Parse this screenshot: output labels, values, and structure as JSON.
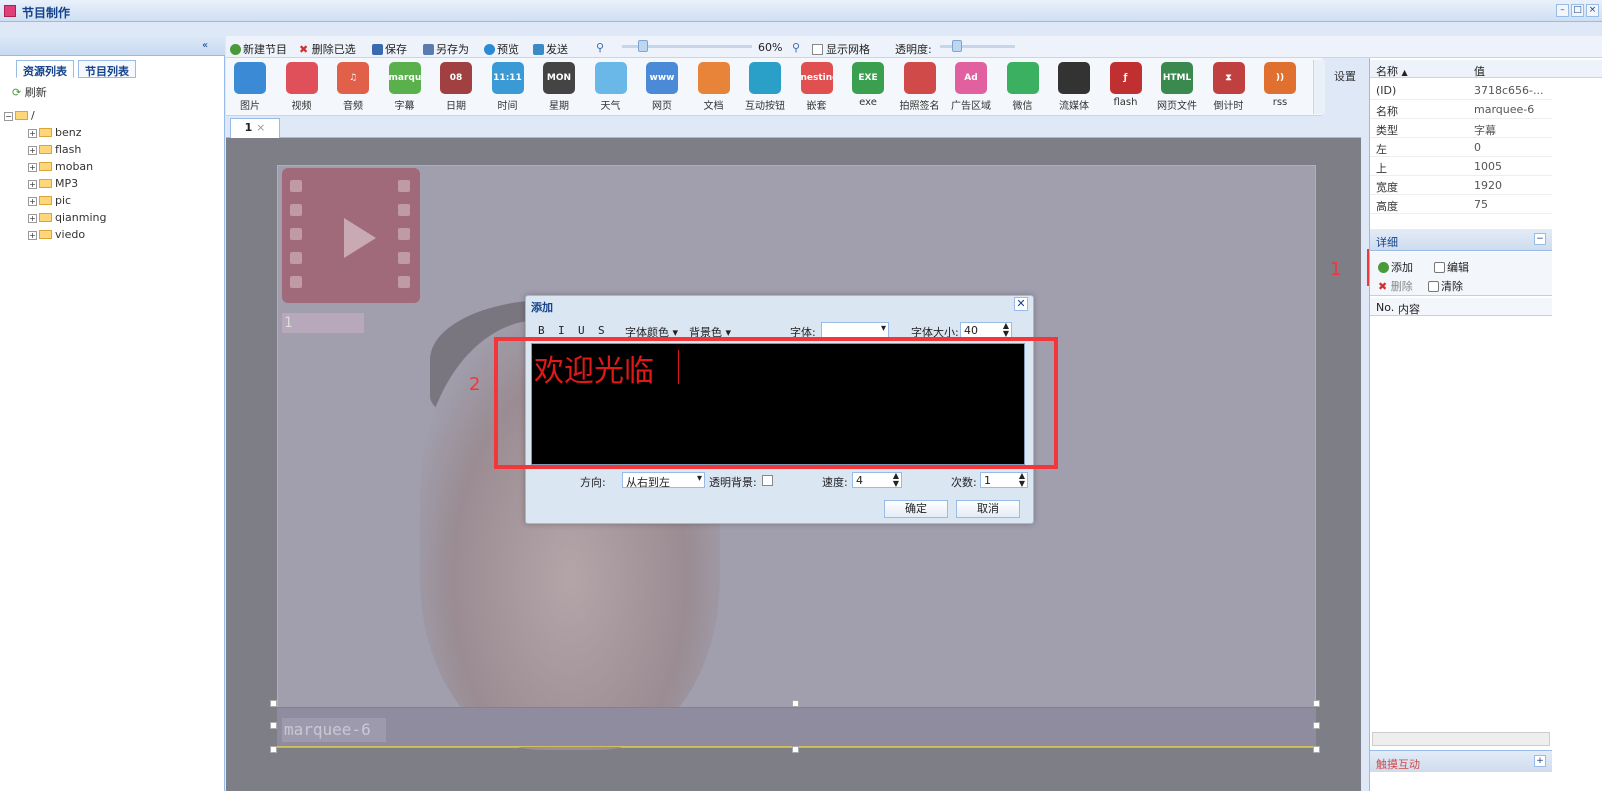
{
  "window": {
    "title": "节目制作"
  },
  "left_panel": {
    "tabs": [
      "资源列表",
      "节目列表"
    ],
    "refresh_label": "刷新",
    "root": "/",
    "folders": [
      "benz",
      "flash",
      "moban",
      "MP3",
      "pic",
      "qianming",
      "viedo"
    ]
  },
  "toolbar": {
    "new_program": "新建节目",
    "delete_selected": "删除已选",
    "save": "保存",
    "save_as": "另存为",
    "preview": "预览",
    "send": "发送",
    "zoom": "60%",
    "show_grid": "显示网格",
    "opacity": "透明度:"
  },
  "resources": [
    {
      "label": "图片",
      "icon": "image-icon",
      "color": "#3a8ad6"
    },
    {
      "label": "视频",
      "icon": "video-icon",
      "color": "#e0505a"
    },
    {
      "label": "音频",
      "icon": "music-icon",
      "color": "#e0604a",
      "glyph": "♫"
    },
    {
      "label": "字幕",
      "icon": "marquee-icon",
      "color": "#5ab04a",
      "glyph": "marquee"
    },
    {
      "label": "日期",
      "icon": "date-icon",
      "color": "#a04040",
      "glyph": "08"
    },
    {
      "label": "时间",
      "icon": "time-icon",
      "color": "#3a9ad6",
      "glyph": "11:11"
    },
    {
      "label": "星期",
      "icon": "weekday-icon",
      "color": "#444444",
      "glyph": "MON"
    },
    {
      "label": "天气",
      "icon": "weather-icon",
      "color": "#6ab8e8"
    },
    {
      "label": "网页",
      "icon": "webpage-icon",
      "color": "#4a8ad6",
      "glyph": "www"
    },
    {
      "label": "文档",
      "icon": "document-icon",
      "color": "#e8843a"
    },
    {
      "label": "互动按钮",
      "icon": "interactive-button-icon",
      "color": "#2aa0c8"
    },
    {
      "label": "嵌套",
      "icon": "nesting-icon",
      "color": "#e05050",
      "glyph": "nesting"
    },
    {
      "label": "exe",
      "icon": "exe-icon",
      "color": "#3aa050",
      "glyph": "EXE"
    },
    {
      "label": "拍照签名",
      "icon": "photo-sign-icon",
      "color": "#d04a4a"
    },
    {
      "label": "广告区域",
      "icon": "ad-area-icon",
      "color": "#e060a0",
      "glyph": "Ad"
    },
    {
      "label": "微信",
      "icon": "wechat-icon",
      "color": "#3ab060"
    },
    {
      "label": "流媒体",
      "icon": "streaming-icon",
      "color": "#333333"
    },
    {
      "label": "flash",
      "icon": "flash-icon",
      "color": "#c03030",
      "glyph": "ƒ"
    },
    {
      "label": "网页文件",
      "icon": "html-file-icon",
      "color": "#3a8a50",
      "glyph": "HTML"
    },
    {
      "label": "倒计时",
      "icon": "countdown-icon",
      "color": "#c04040",
      "glyph": "⧗"
    },
    {
      "label": "rss",
      "icon": "rss-icon",
      "color": "#e07030",
      "glyph": "))"
    }
  ],
  "settings_label": "设置",
  "doc_tab": "1",
  "canvas": {
    "video_label": "1",
    "marquee_label": "marquee-6"
  },
  "dialog": {
    "title": "添加",
    "bold": "B",
    "italic": "I",
    "underline": "U",
    "strike": "S",
    "font_color": "字体颜色",
    "bg_color": "背景色",
    "font_label": "字体:",
    "font_size_label": "字体大小:",
    "font_size_value": "40",
    "editor_text": "欢迎光临",
    "direction_label": "方向:",
    "direction_value": "从右到左",
    "transparent_bg_label": "透明背景:",
    "speed_label": "速度:",
    "speed_value": "4",
    "count_label": "次数:",
    "count_value": "1",
    "ok": "确定",
    "cancel": "取消"
  },
  "annotations": {
    "n1": "1",
    "n2": "2"
  },
  "properties": {
    "col_name": "名称",
    "col_value": "值",
    "rows": [
      {
        "k": "(ID)",
        "v": "3718c656-..."
      },
      {
        "k": "名称",
        "v": "marquee-6"
      },
      {
        "k": "类型",
        "v": "字幕"
      },
      {
        "k": "左",
        "v": "0"
      },
      {
        "k": "上",
        "v": "1005"
      },
      {
        "k": "宽度",
        "v": "1920"
      },
      {
        "k": "高度",
        "v": "75"
      }
    ]
  },
  "detail": {
    "title": "详细",
    "add": "添加",
    "edit": "编辑",
    "delete": "删除",
    "clear": "清除",
    "col_no": "No.",
    "col_content": "内容"
  },
  "footer": {
    "label": "触摸互动"
  }
}
